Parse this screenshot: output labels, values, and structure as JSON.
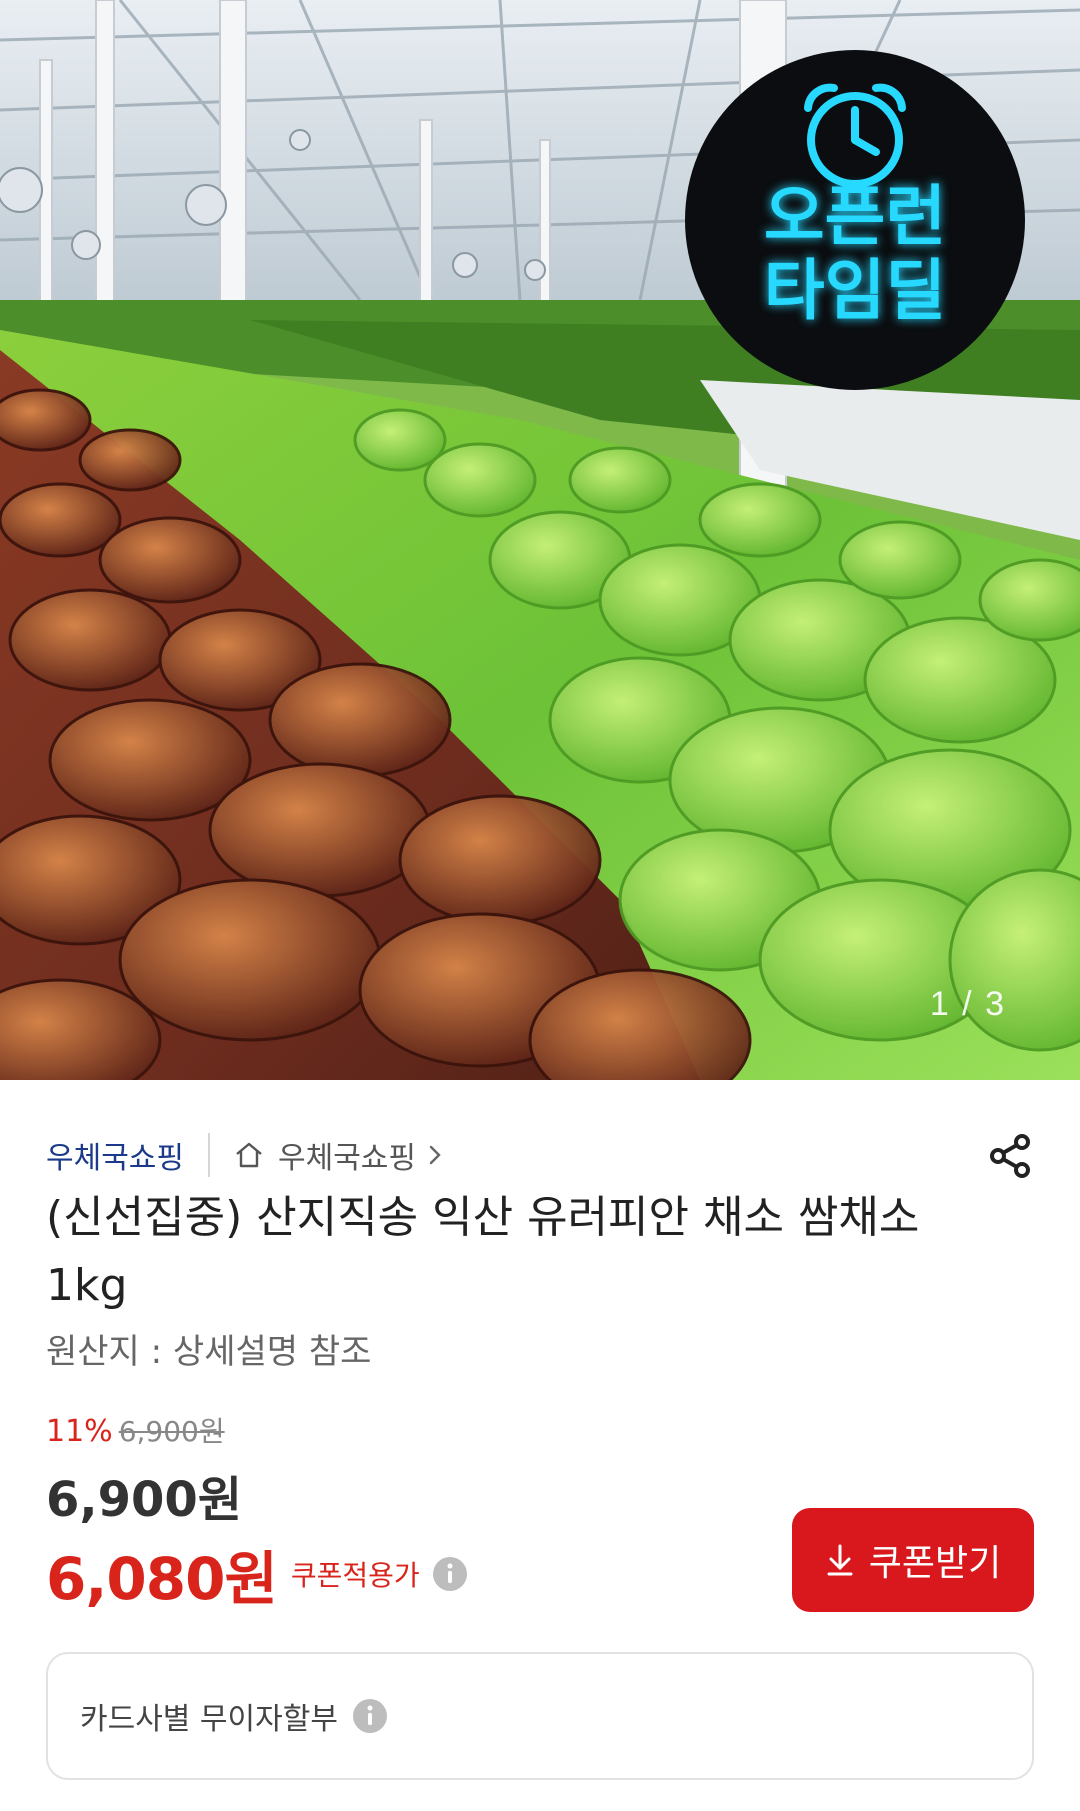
{
  "hero": {
    "badge_line1": "오픈런",
    "badge_line2": "타임딜",
    "counter": "1 / 3"
  },
  "breadcrumb": {
    "seller": "우체국쇼핑",
    "store_link": "우체국쇼핑"
  },
  "product": {
    "title": "(신선집중) 산지직송 익산 유러피안 채소 쌈채소 1kg",
    "origin": "원산지 : 상세설명 참조"
  },
  "pricing": {
    "discount_rate": "11%",
    "original_price": "6,900원",
    "price": "6,900원",
    "coupon_price": "6,080원",
    "coupon_label": "쿠폰적용가",
    "coupon_button": "쿠폰받기"
  },
  "card": {
    "label": "카드사별 무이자할부"
  },
  "icons": [
    "home-icon",
    "chevron-right-icon",
    "share-icon",
    "info-icon",
    "download-icon"
  ],
  "colors": {
    "brand_red": "#d8181c",
    "seller_blue": "#1b3a8a",
    "badge_neon": "#27d9ff"
  }
}
